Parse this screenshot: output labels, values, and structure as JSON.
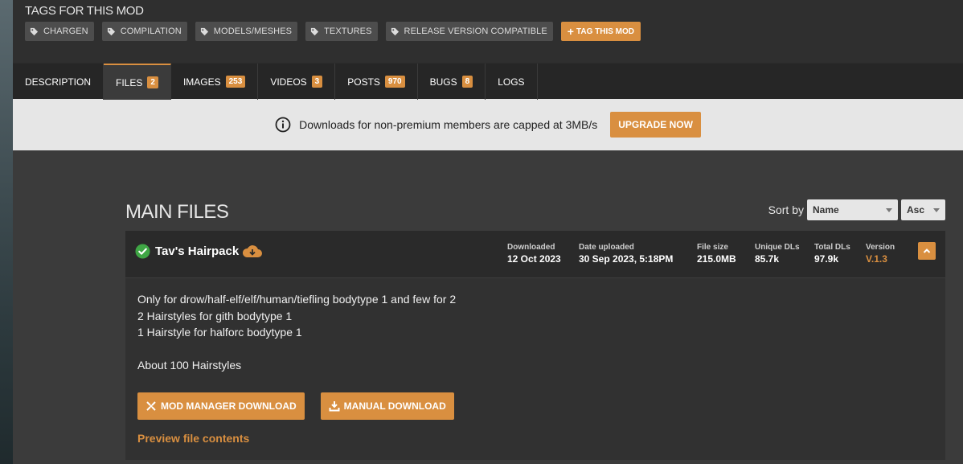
{
  "tags": {
    "title": "TAGS FOR THIS MOD",
    "items": [
      "CHARGEN",
      "COMPILATION",
      "MODELS/MESHES",
      "TEXTURES",
      "RELEASE VERSION COMPATIBLE"
    ],
    "add_label": "TAG THIS MOD"
  },
  "tabs": [
    {
      "label": "DESCRIPTION",
      "badge": ""
    },
    {
      "label": "FILES",
      "badge": "2"
    },
    {
      "label": "IMAGES",
      "badge": "253"
    },
    {
      "label": "VIDEOS",
      "badge": "3"
    },
    {
      "label": "POSTS",
      "badge": "970"
    },
    {
      "label": "BUGS",
      "badge": "8"
    },
    {
      "label": "LOGS",
      "badge": ""
    }
  ],
  "notice": {
    "text": "Downloads for non-premium members are capped at 3MB/s",
    "button": "UPGRADE NOW"
  },
  "files": {
    "title": "MAIN FILES",
    "sort_label": "Sort by",
    "sort_field": "Name",
    "sort_order": "Asc"
  },
  "file": {
    "name": "Tav's Hairpack",
    "meta": {
      "downloaded_label": "Downloaded",
      "downloaded": "12 Oct 2023",
      "uploaded_label": "Date uploaded",
      "uploaded": "30 Sep 2023, 5:18PM",
      "size_label": "File size",
      "size": "215.0MB",
      "unique_label": "Unique DLs",
      "unique": "85.7k",
      "total_label": "Total DLs",
      "total": "97.9k",
      "version_label": "Version",
      "version": "V.1.3"
    },
    "description": [
      "Only for drow/half-elf/elf/human/tiefling bodytype 1 and few for 2",
      "2 Hairstyles for gith bodytype 1",
      "1 Hairstyle for halforc bodytype 1",
      "",
      "About 100 Hairstyles"
    ],
    "mod_manager_label": "MOD MANAGER DOWNLOAD",
    "manual_label": "MANUAL DOWNLOAD",
    "preview_label": "Preview file contents"
  },
  "colors": {
    "accent": "#d98f40",
    "success": "#3fa645"
  }
}
